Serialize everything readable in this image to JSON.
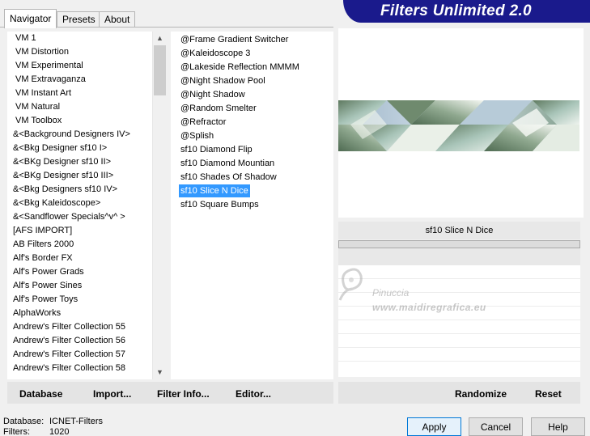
{
  "app": {
    "title": "Filters Unlimited 2.0",
    "colors": {
      "banner": "#1a1a8c",
      "selection": "#3399ff"
    }
  },
  "tabs": [
    {
      "label": "Navigator",
      "active": true
    },
    {
      "label": "Presets",
      "active": false
    },
    {
      "label": "About",
      "active": false
    }
  ],
  "categories": [
    "VM 1",
    "VM Distortion",
    "VM Experimental",
    "VM Extravaganza",
    "VM Instant Art",
    "VM Natural",
    "VM Toolbox",
    "&<Background Designers IV>",
    "&<Bkg Designer sf10 I>",
    "&<BKg Designer sf10 II>",
    "&<BKg Designer sf10 III>",
    "&<Bkg Designers sf10 IV>",
    "&<Bkg Kaleidoscope>",
    "&<Sandflower Specials^v^ >",
    "[AFS IMPORT]",
    "AB Filters 2000",
    "Alf's Border FX",
    "Alf's Power Grads",
    "Alf's Power Sines",
    "Alf's Power Toys",
    "AlphaWorks",
    "Andrew's Filter Collection 55",
    "Andrew's Filter Collection 56",
    "Andrew's Filter Collection 57",
    "Andrew's Filter Collection 58"
  ],
  "filters": [
    "@Frame Gradient Switcher",
    "@Kaleidoscope 3",
    "@Lakeside Reflection MMMM",
    "@Night Shadow Pool",
    "@Night Shadow",
    "@Random Smelter",
    "@Refractor",
    "@Splish",
    "sf10 Diamond Flip",
    "sf10 Diamond Mountian",
    "sf10 Shades Of Shadow",
    "sf10 Slice N Dice",
    "sf10 Square Bumps"
  ],
  "selected_filter_index": 11,
  "preview": {
    "filter_name": "sf10 Slice N Dice"
  },
  "watermark": {
    "name": "Pinuccia",
    "url": "www.maidiregrafica.eu"
  },
  "toolbar": {
    "database": "Database",
    "import": "Import...",
    "filter_info": "Filter Info...",
    "editor": "Editor...",
    "randomize": "Randomize",
    "reset": "Reset"
  },
  "status": {
    "database_label": "Database:",
    "database_value": "ICNET-Filters",
    "filters_label": "Filters:",
    "filters_value": "1020"
  },
  "dialog": {
    "apply": "Apply",
    "cancel": "Cancel",
    "help": "Help"
  }
}
